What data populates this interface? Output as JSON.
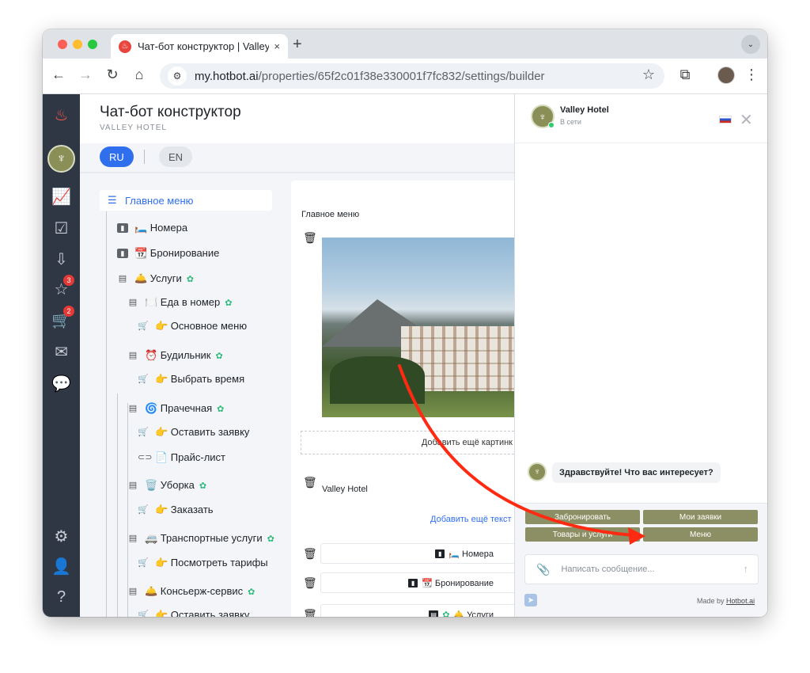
{
  "browser": {
    "tab_title": "Чат-бот конструктор | Valley",
    "tab_close": "×",
    "new_tab": "+",
    "url_host": "my.hotbot.ai",
    "url_path": "/properties/65f2c01f38e330001f7fc832/settings/builder"
  },
  "page": {
    "title": "Чат-бот конструктор",
    "subtitle": "VALLEY HOTEL",
    "lang_ru": "RU",
    "lang_en": "EN"
  },
  "rail": {
    "badge_services": "3",
    "badge_cart": "2"
  },
  "tree": {
    "root": "Главное меню",
    "items": [
      "🛏️ Номера",
      "📆 Бронирование",
      "🛎️ Услуги",
      "🍽️ Еда в номер",
      "👉 Основное меню",
      "⏰ Будильник",
      "👉 Выбрать время",
      "🌀 Прачечная",
      "👉 Оставить заявку",
      "📄 Прайс-лист",
      "🗑️ Уборка",
      "👉 Заказать",
      "🚐 Транспортные услуги",
      "👉 Посмотреть тарифы",
      "🛎️ Консьерж-сервис",
      "👉 Оставить заявку"
    ]
  },
  "editor": {
    "label": "Главное меню",
    "add_image": "Добавить ещё картинк",
    "text_block": "Valley Hotel",
    "add_text": "Добавить ещё текст",
    "button_rows": [
      "🛏️ Номера",
      "📆 Бронирование",
      "🛎️ Услуги"
    ]
  },
  "chat": {
    "name": "Valley Hotel",
    "status": "В сети",
    "greeting": "Здравствуйте! Что вас интересует?",
    "quick_replies": [
      "Забронировать",
      "Мои заявки",
      "Товары и услуги",
      "Меню"
    ],
    "placeholder": "Написать сообщение...",
    "made_by": "Made by",
    "made_by_link": "Hotbot.ai"
  },
  "colors": {
    "accent": "#2f6fed",
    "rail": "#2f3745",
    "quick_reply": "#8c8f63",
    "arrow": "#ff2a12"
  }
}
